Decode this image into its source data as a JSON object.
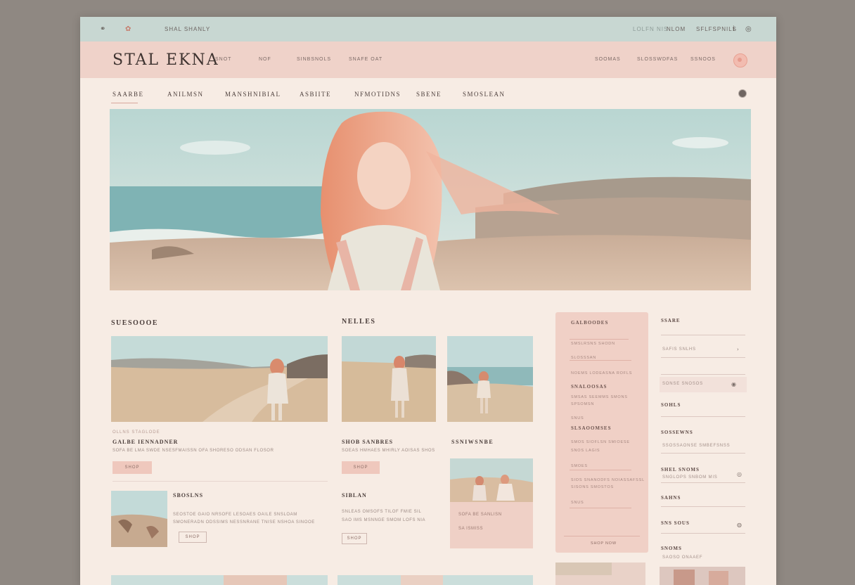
{
  "topbar": {
    "left_icons": [
      "link-icon",
      "bookmark-icon"
    ],
    "left_text": "SHAL SHANLY",
    "right_links": [
      "LOLFN NIS",
      "NLOM",
      "SFLFSPNILS"
    ],
    "right_icons": [
      "info-icon",
      "globe-icon"
    ]
  },
  "header": {
    "logo": "STAL EKNA",
    "nav": [
      "SNOT",
      "NOF",
      "SINBSNOLS",
      "SNAFE OAT"
    ],
    "right_links": [
      "SOOMAS",
      "SLOSSWDFAS",
      "SSNOOS"
    ]
  },
  "categories": [
    "SAARBE",
    "ANILMSN",
    "MANSHNIBIAL",
    "ASBIITE",
    "NFMOTIDNS",
    "SBENE",
    "SMOSLEAN"
  ],
  "sections": {
    "left": "SUESOOOE",
    "mid": "NELLES",
    "mid2": "SSNIWSNBE"
  },
  "card1": {
    "label": "OLLNS STAGLODE",
    "title": "GALBE IENNADNER",
    "desc": "SOFA BE LMA SWDE NSESFMAISSN OFA SHORESO ODSAN FLOSOR",
    "button": "SHOP"
  },
  "card2": {
    "title": "SHOB SANBRES",
    "desc": "SOEAS HMHAES MHIRLY AOISAS SHOS",
    "button": "SHOP"
  },
  "card3": {
    "title": "SBOSLNS",
    "desc1": "SEOSTOE GAIO NRSOFE LESOAES OAILE SNSLOAM",
    "desc2": "SMONERADN ODSSIMS NESSNRANE TNISE NSHOA SINOOE",
    "button": "SHOP"
  },
  "card4": {
    "title": "SIBLAN",
    "desc1": "SNLEAS OMSOFS TILOF FMIE SIL",
    "desc2": "SAO IMS MSNNGE SMOM LOFS NIA",
    "button": "SHOP"
  },
  "promo": {
    "line1": "SOFA BE SANLISN",
    "line2": "SA ISMISS",
    "icons": [
      "a",
      "b",
      "c"
    ]
  },
  "sidecard": {
    "title": "GALBOODES",
    "s1": "SMSLRSNS SHODN",
    "s2": "SLOSSSAN",
    "s3": "NOEMS LODEASNA ROFLS",
    "t2": "SNALOOSAS",
    "s4": "SMSAS SEEMMS SMONS",
    "s5": "SPSOMSN",
    "t3": "SLSAOOMSES",
    "s6": "SMOS SIOFLSN SMIOESE",
    "s7": "SNOS LAGIS",
    "s8": "SIOS SNANODFS NOIASSAFSSL",
    "s9": "SISONS SMOSTOS",
    "s10": "SNUS",
    "s11": "SMOES",
    "button": "SHOP NOW"
  },
  "rightpanel": {
    "title": "SSARE",
    "input": "SAFIS SNLHS",
    "row1": "SONSE SNOSOS",
    "t2": "SOHLS",
    "t3": "SOSSEWNS",
    "s3a": "SSOS",
    "s3b": "SAONSE SMBEFSNSS",
    "t4": "SHEL SNOMS",
    "s4": "SNGLOPS SNBOM MIS",
    "t5": "SAHNS",
    "t6": "SNS SOUS",
    "t7": "SNOMS",
    "s7": "SAOSO ONAAEF"
  }
}
